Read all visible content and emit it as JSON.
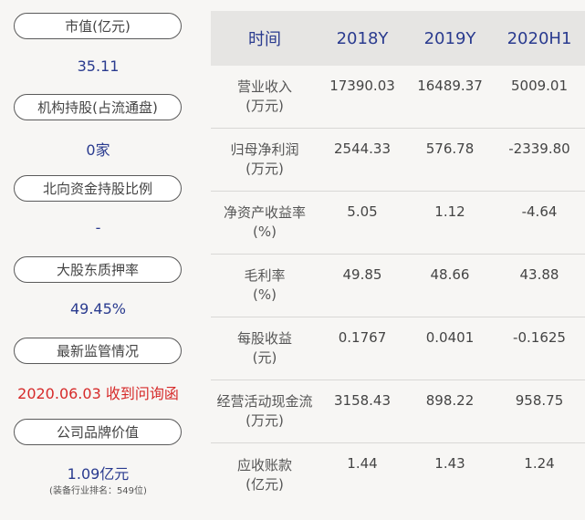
{
  "left": {
    "items": [
      {
        "label": "市值(亿元)",
        "value": "35.11"
      },
      {
        "label": "机构持股(占流通盘)",
        "value": "0家"
      },
      {
        "label": "北向资金持股比例",
        "value": "-"
      },
      {
        "label": "大股东质押率",
        "value": "49.45%"
      },
      {
        "label": "最新监管情况",
        "value": "2020.06.03 收到问询函"
      },
      {
        "label": "公司品牌价值",
        "value": "1.09亿元",
        "note": "(装备行业排名：549位)"
      }
    ],
    "colors": {
      "value": "#2a3b8f",
      "alert": "#d62a2a"
    }
  },
  "table": {
    "headers": [
      "时间",
      "2018Y",
      "2019Y",
      "2020H1"
    ],
    "rows": [
      {
        "label_line1": "营业收入",
        "label_line2": "(万元)",
        "values": [
          "17390.03",
          "16489.37",
          "5009.01"
        ]
      },
      {
        "label_line1": "归母净利润",
        "label_line2": "(万元)",
        "values": [
          "2544.33",
          "576.78",
          "-2339.80"
        ]
      },
      {
        "label_line1": "净资产收益率",
        "label_line2": "(%)",
        "values": [
          "5.05",
          "1.12",
          "-4.64"
        ]
      },
      {
        "label_line1": "毛利率",
        "label_line2": "(%)",
        "values": [
          "49.85",
          "48.66",
          "43.88"
        ]
      },
      {
        "label_line1": "每股收益",
        "label_line2": "(元)",
        "values": [
          "0.1767",
          "0.0401",
          "-0.1625"
        ]
      },
      {
        "label_line1": "经营活动现金流",
        "label_line2": "(万元)",
        "values": [
          "3158.43",
          "898.22",
          "958.75"
        ]
      },
      {
        "label_line1": "应收账款",
        "label_line2": "(亿元)",
        "values": [
          "1.44",
          "1.43",
          "1.24"
        ]
      }
    ]
  }
}
